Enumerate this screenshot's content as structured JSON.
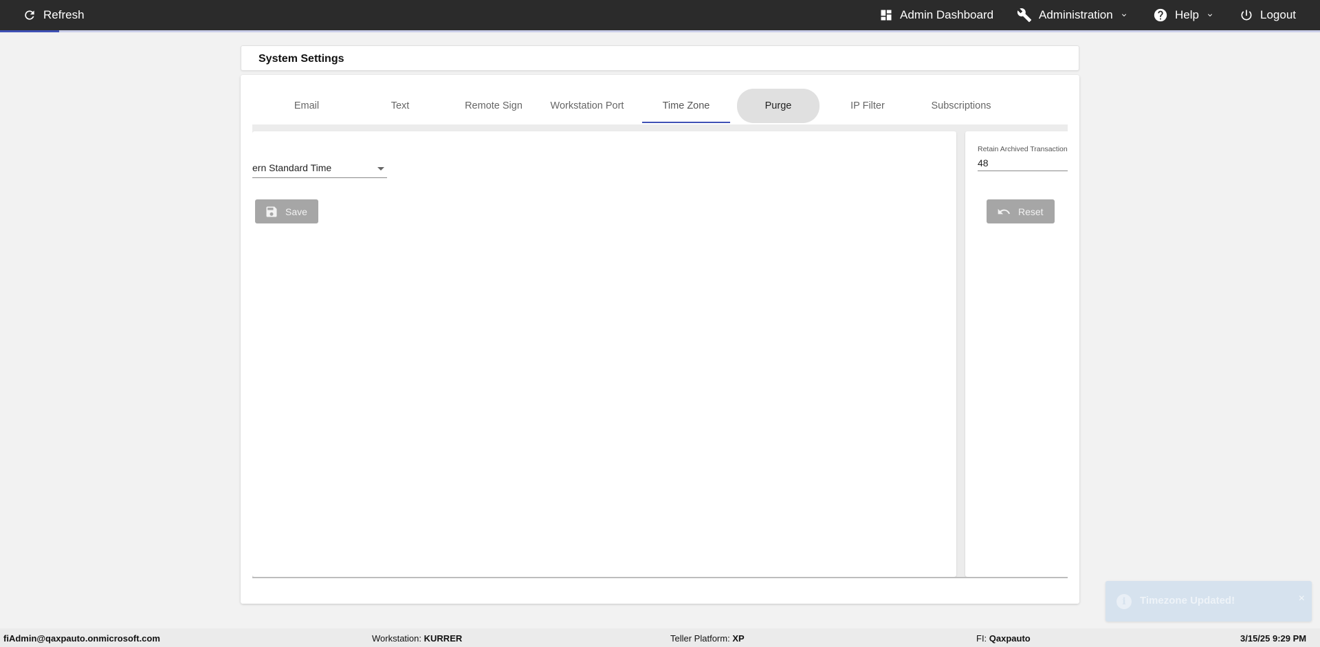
{
  "topbar": {
    "refresh_label": "Refresh",
    "admin_dashboard_label": "Admin Dashboard",
    "administration_label": "Administration",
    "help_label": "Help",
    "logout_label": "Logout",
    "page_load_progress": 0.045
  },
  "page": {
    "title": "System Settings"
  },
  "tabs": [
    {
      "label": "Email"
    },
    {
      "label": "Text"
    },
    {
      "label": "Remote Sign"
    },
    {
      "label": "Workstation Port"
    },
    {
      "label": "Time Zone",
      "active": true
    },
    {
      "label": "Purge",
      "hovered": true
    },
    {
      "label": "IP Filter"
    },
    {
      "label": "Subscriptions"
    }
  ],
  "timezone_panel": {
    "selected_value": "ern Standard Time",
    "save_label": "Save"
  },
  "purge_panel": {
    "field_label": "Retain Archived Transaction",
    "field_value": "48",
    "reset_label": "Reset"
  },
  "toast": {
    "message": "Timezone Updated!",
    "icon": "info-icon",
    "close_glyph": "×"
  },
  "footer": {
    "user": "fiAdmin@qaxpauto.onmicrosoft.com",
    "workstation_label": "Workstation:",
    "workstation_value": "KURRER",
    "teller_platform_label": "Teller Platform:",
    "teller_platform_value": "XP",
    "fi_label": "FI:",
    "fi_value": "Qaxpauto",
    "datetime": "3/15/25 9:29 PM"
  },
  "colors": {
    "topbar_bg": "#2b2b2b",
    "accent": "#3f51b5",
    "button_bg": "#a6a6a6",
    "toast_bg": "#d6e2ee"
  }
}
